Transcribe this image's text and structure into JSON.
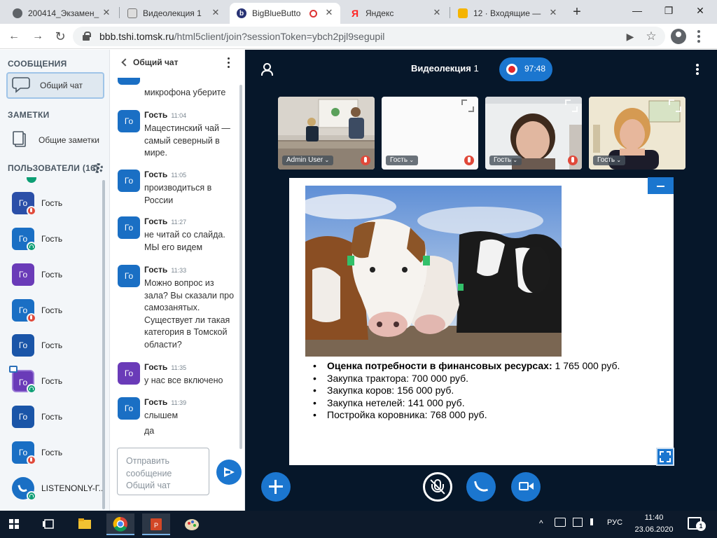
{
  "browser": {
    "tabs": [
      {
        "title": "200414_Экзамен_",
        "icon": "globe-icon",
        "active": false
      },
      {
        "title": "Видеолекция 1",
        "icon": "document-icon",
        "active": false
      },
      {
        "title": "BigBlueButto",
        "icon": "bigbluebutton-icon",
        "active": true
      },
      {
        "title": "Яндекс",
        "icon": "yandex-icon",
        "active": false
      },
      {
        "title": "12 · Входящие —",
        "icon": "mail-icon",
        "active": false
      }
    ],
    "close_glyph": "✕",
    "new_tab_glyph": "+",
    "window_buttons": {
      "minimize": "—",
      "restore": "❐",
      "close": "✕"
    },
    "url_host": "bbb.tshi.tomsk.ru",
    "url_rest": "/html5client/join?sessionToken=ybch2pjl9segupil",
    "nav": {
      "back": "←",
      "forward": "→",
      "reload": "↻"
    },
    "omni_icons": {
      "camera": "▶",
      "star": "☆"
    }
  },
  "sidebar": {
    "messages_title": "СООБЩЕНИЯ",
    "public_chat_label": "Общий чат",
    "notes_title": "ЗАМЕТКИ",
    "shared_notes_label": "Общие заметки",
    "users_title": "ПОЛЬЗОВАТЕЛИ (16)",
    "users": [
      {
        "initials": "Го",
        "name": "Гость",
        "color": "#2b4fa8",
        "status": "muted"
      },
      {
        "initials": "Го",
        "name": "Гость",
        "color": "#1a6fc4",
        "status": "listen"
      },
      {
        "initials": "Го",
        "name": "Гость",
        "color": "#6a3bb8",
        "status": "none"
      },
      {
        "initials": "Го",
        "name": "Гость",
        "color": "#1a6fc4",
        "status": "muted"
      },
      {
        "initials": "Го",
        "name": "Гость",
        "color": "#1a55a8",
        "status": "none"
      },
      {
        "initials": "Го",
        "name": "Гость",
        "color": "#6a3bb8",
        "status": "listen",
        "presenter": true
      },
      {
        "initials": "Го",
        "name": "Гость",
        "color": "#1a55a8",
        "status": "none"
      },
      {
        "initials": "Го",
        "name": "Гость",
        "color": "#1a6fc4",
        "status": "muted"
      },
      {
        "initials": "",
        "name": "LISTENONLY-Г...",
        "color": "#1a6fc4",
        "status": "listen",
        "round": true
      }
    ]
  },
  "chat": {
    "title": "Общий чат",
    "partial_text": "микрофона уберите",
    "messages": [
      {
        "avatar": "Го",
        "color": "#1a6fc4",
        "sender": "Гость",
        "time": "11:04",
        "text": "Мацестинский чай — самый северный в мире."
      },
      {
        "avatar": "Го",
        "color": "#1a6fc4",
        "sender": "Гость",
        "time": "11:05",
        "text": "производиться в России"
      },
      {
        "avatar": "Го",
        "color": "#1a6fc4",
        "sender": "Гость",
        "time": "11:27",
        "text": "не читай со слайда. МЫ его видем"
      },
      {
        "avatar": "Го",
        "color": "#1a6fc4",
        "sender": "Гость",
        "time": "11:33",
        "text": "Можно вопрос из зала? Вы сказали про самозанятых. Существует ли такая категория в Томской области?"
      },
      {
        "avatar": "Го",
        "color": "#6a3bb8",
        "sender": "Гость",
        "time": "11:35",
        "text": "у нас все включено"
      },
      {
        "avatar": "Го",
        "color": "#1a6fc4",
        "sender": "Гость",
        "time": "11:39",
        "text": "слышем"
      }
    ],
    "followup_text": "да",
    "input_placeholder": "Отправить сообщение Общий чат"
  },
  "conference": {
    "title": "Видеолекция",
    "title_num": "1",
    "recording_time": "97:48",
    "webcams": [
      {
        "label": "Admin User",
        "muted": true
      },
      {
        "label": "Гость",
        "muted": true
      },
      {
        "label": "Гость",
        "muted": true
      },
      {
        "label": "Гость",
        "muted": false
      }
    ],
    "slide": {
      "bullets": [
        {
          "bold": "Оценка потребности в финансовых ресурсах:",
          "text": " 1 765 000 руб."
        },
        {
          "bold": "",
          "text": "Закупка трактора: 700 000 руб."
        },
        {
          "bold": "",
          "text": "Закупка коров: 156 000 руб."
        },
        {
          "bold": "",
          "text": "Закупка нетелей: 141 000 руб."
        },
        {
          "bold": "",
          "text": "Постройка коровника: 768 000 руб."
        }
      ]
    }
  },
  "taskbar": {
    "lang": "РУС",
    "time": "11:40",
    "date": "23.06.2020",
    "notifications": "1",
    "tray_caret": "^"
  },
  "colors": {
    "accent": "#1b76cf",
    "conference_bg": "#06172a",
    "recording": "#e3262b",
    "muted": "#e0493a",
    "listen": "#0c9e74"
  }
}
